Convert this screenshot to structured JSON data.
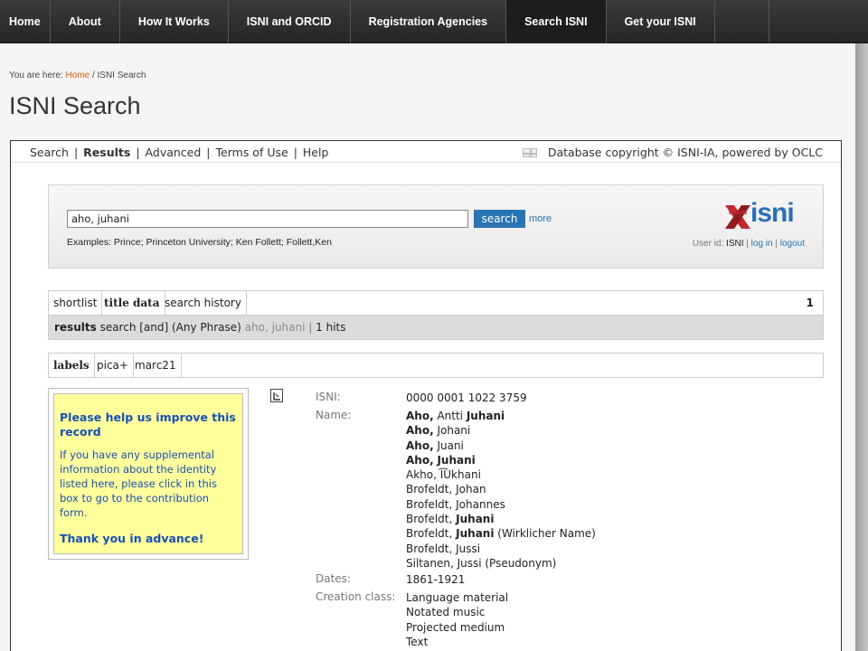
{
  "topnav": {
    "items": [
      "Home",
      "About",
      "How It Works",
      "ISNI and ORCID",
      "Registration Agencies",
      "Search ISNI",
      "Get your ISNI"
    ],
    "active": "Search ISNI"
  },
  "breadcrumb": {
    "prefix": "You are here:",
    "home": "Home",
    "current": "/ ISNI Search"
  },
  "page_title": "ISNI Search",
  "subnav": {
    "links": [
      "Search",
      "Results",
      "Advanced",
      "Terms of Use",
      "Help"
    ],
    "active": "Results",
    "copyright": "Database copyright © ISNI-IA, powered by OCLC"
  },
  "search": {
    "value": "aho, juhani",
    "button": "search",
    "more": "more",
    "examples": "Examples: Prince; Princeton University; Ken Follett; Follett,Ken",
    "logo_text": "isni",
    "user": {
      "prefix": "User id:",
      "id": "ISNI",
      "sep": "|",
      "login": "log in",
      "logout": "logout"
    }
  },
  "tabs": {
    "items": [
      "shortlist",
      "title data",
      "search history"
    ],
    "active": "title data",
    "count": "1"
  },
  "results_bar": {
    "label": "results",
    "query": "search [and] (Any Phrase)",
    "term": "aho, juhani",
    "sep": "|",
    "hits": "1 hits"
  },
  "formats": {
    "items": [
      "labels",
      "pica+",
      "marc21"
    ],
    "active": "labels"
  },
  "help": {
    "title_line1": "Please help us improve this",
    "title_line2": "record",
    "body": [
      "If you have any supplemental",
      "information about the identity",
      "listed here, please click in this",
      "box to go to the contribution form."
    ],
    "thanks": "Thank you in advance!"
  },
  "record": {
    "isni_label": "ISNI:",
    "isni": "0000 0001 1022 3759",
    "name_label": "Name:",
    "names": [
      {
        "pre": "Aho,",
        "pre_bold": true,
        "mid": " Antti ",
        "bold": "Juhani",
        "post": ""
      },
      {
        "pre": "Aho,",
        "pre_bold": true,
        "mid": " Johani",
        "bold": "",
        "post": ""
      },
      {
        "pre": "Aho,",
        "pre_bold": true,
        "mid": " Juani",
        "bold": "",
        "post": ""
      },
      {
        "pre": "Aho,",
        "pre_bold": true,
        "mid": " ",
        "bold": "Juhani",
        "post": ""
      },
      {
        "pre": "",
        "pre_bold": false,
        "mid": "Akho, I͡Ukhani",
        "bold": "",
        "post": ""
      },
      {
        "pre": "",
        "pre_bold": false,
        "mid": "Brofeldt, Johan",
        "bold": "",
        "post": ""
      },
      {
        "pre": "",
        "pre_bold": false,
        "mid": "Brofeldt, Johannes",
        "bold": "",
        "post": ""
      },
      {
        "pre": "",
        "pre_bold": false,
        "mid": "Brofeldt, ",
        "bold": "Juhani",
        "post": ""
      },
      {
        "pre": "",
        "pre_bold": false,
        "mid": "Brofeldt, ",
        "bold": "Juhani",
        "post": " (Wirklicher Name)"
      },
      {
        "pre": "",
        "pre_bold": false,
        "mid": "Brofeldt, Jussi",
        "bold": "",
        "post": ""
      },
      {
        "pre": "",
        "pre_bold": false,
        "mid": "Siltanen, Jussi (Pseudonym)",
        "bold": "",
        "post": ""
      }
    ],
    "dates_label": "Dates:",
    "dates": "1861-1921",
    "creation_label": "Creation class:",
    "creation": [
      "Language material",
      "Notated music",
      "Projected medium",
      "Text"
    ]
  },
  "colors": {
    "accent": "#2a74b3",
    "help_bg": "#ffff9c",
    "help_text": "#1a4fb3",
    "nav_bg": "#2e2e2e",
    "breadcrumb_home": "#e25b12"
  }
}
